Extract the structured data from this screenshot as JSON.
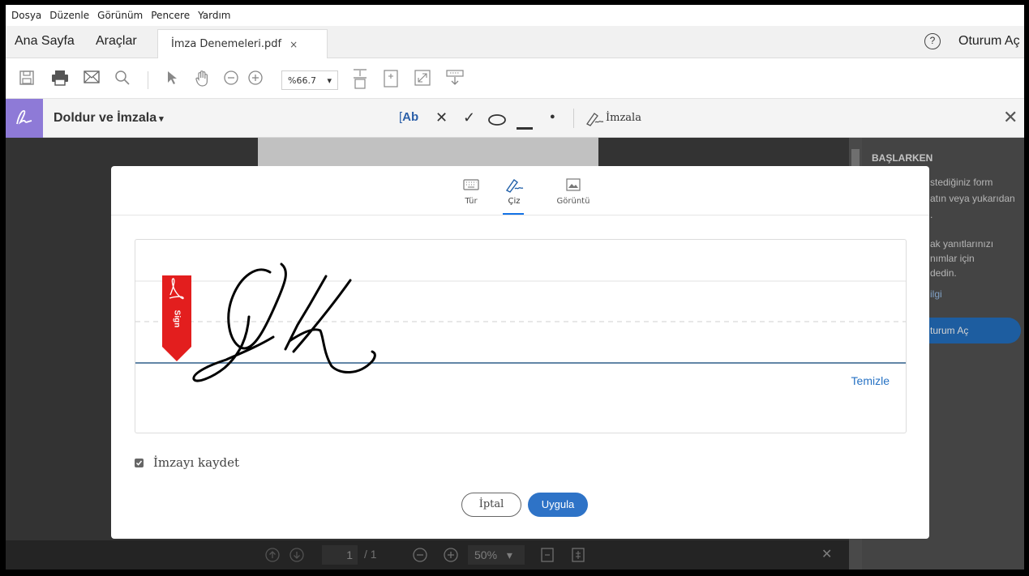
{
  "menu": [
    "Dosya",
    "Düzenle",
    "Görünüm",
    "Pencere",
    "Yardım"
  ],
  "tabs": {
    "home": "Ana Sayfa",
    "tools": "Araçlar",
    "document": "İmza Denemeleri.pdf",
    "close_glyph": "×",
    "help_glyph": "?",
    "sign_in": "Oturum Aç"
  },
  "toolbar": {
    "zoom": "%66.7",
    "zoom_arrow": "▾"
  },
  "fill_sign": {
    "title": "Doldur ve İmzala",
    "title_arrow": "▾",
    "text_tool": "Ab",
    "cross_glyph": "✕",
    "check_glyph": "✓",
    "dot_glyph": "●",
    "sign_label": "İmzala",
    "close_glyph": "✕"
  },
  "side_panel": {
    "heading": "BAŞLARKEN",
    "lines": [
      "stediğiniz form",
      "atın veya yukarıdan",
      ".",
      "ak yanıtlarınızı",
      "nımlar için",
      "dedin.",
      "ilgi"
    ],
    "button": "turum Aç"
  },
  "bottom_bar": {
    "page_current": "1",
    "page_total": "/ 1",
    "zoom": "50%",
    "zoom_arrow": "▾",
    "close_glyph": "✕"
  },
  "modal": {
    "tabs": [
      {
        "label": "Tür",
        "icon": "keyboard-icon"
      },
      {
        "label": "Çiz",
        "icon": "pen-draw-icon",
        "active": true
      },
      {
        "label": "Görüntü",
        "icon": "image-icon"
      }
    ],
    "sign_flag": "Sign",
    "clear": "Temizle",
    "save_signature": "İmzayı kaydet",
    "save_checked": true,
    "cancel": "İptal",
    "apply": "Uygula"
  },
  "colors": {
    "accent_blue": "#2e73c7",
    "fill_sign_purple": "#8e7ad7",
    "sign_flag_red": "#e31e1e"
  }
}
